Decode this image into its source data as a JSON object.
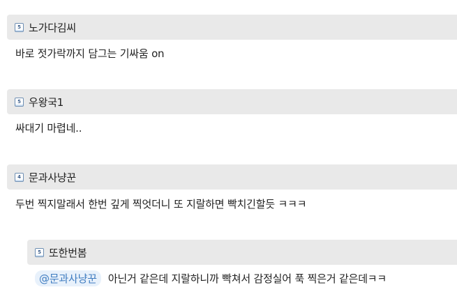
{
  "comments": [
    {
      "level": "5",
      "nickname": "노가다김씨",
      "text": "바로 젓가락까지 담그는 기싸움 on"
    },
    {
      "level": "5",
      "nickname": "우왕국1",
      "text": "싸대기 마렵네.."
    },
    {
      "level": "4",
      "nickname": "문과사냥꾼",
      "text": "두번 찍지말래서 한번 깊게 찍엇더니 또 지랄하면 빡치긴할듯 ㅋㅋㅋ"
    }
  ],
  "reply": {
    "level": "5",
    "nickname": "또한번봄",
    "mention": "@문과사냥꾼",
    "text": "아닌거 같은데 지랄하니까 빡쳐서 감정실어 푹 찍은거 같은데ㅋㅋ"
  }
}
